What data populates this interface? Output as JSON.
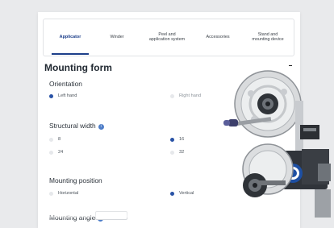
{
  "tabs": [
    {
      "label": "Applicator",
      "active": true
    },
    {
      "label": "Winder",
      "active": false
    },
    {
      "label": "Peel and application system",
      "active": false
    },
    {
      "label": "Accessories",
      "active": false
    },
    {
      "label": "Stand and mounting device",
      "active": false
    }
  ],
  "form": {
    "title": "Mounting form",
    "orientation": {
      "label": "Orientation",
      "options": [
        {
          "label": "Left hand",
          "selected": true
        },
        {
          "label": "Right hand",
          "selected": false
        }
      ]
    },
    "structural_width": {
      "label": "Structural width",
      "options": [
        {
          "label": "8",
          "selected": false
        },
        {
          "label": "16",
          "selected": true
        },
        {
          "label": "24",
          "selected": false
        },
        {
          "label": "32",
          "selected": false
        }
      ]
    },
    "mounting_position": {
      "label": "Mounting position",
      "options": [
        {
          "label": "Horizontal",
          "selected": false
        },
        {
          "label": "Vertical",
          "selected": true
        }
      ]
    },
    "mounting_angle": {
      "label": "Mounting angle"
    }
  },
  "colors": {
    "accent": "#1d3f8a",
    "selected_dot": "#2953a6",
    "info": "#4f7ec8"
  },
  "icons": {
    "info": "info-icon",
    "collapse": "minus-icon",
    "product": "labeling-machine-image"
  }
}
